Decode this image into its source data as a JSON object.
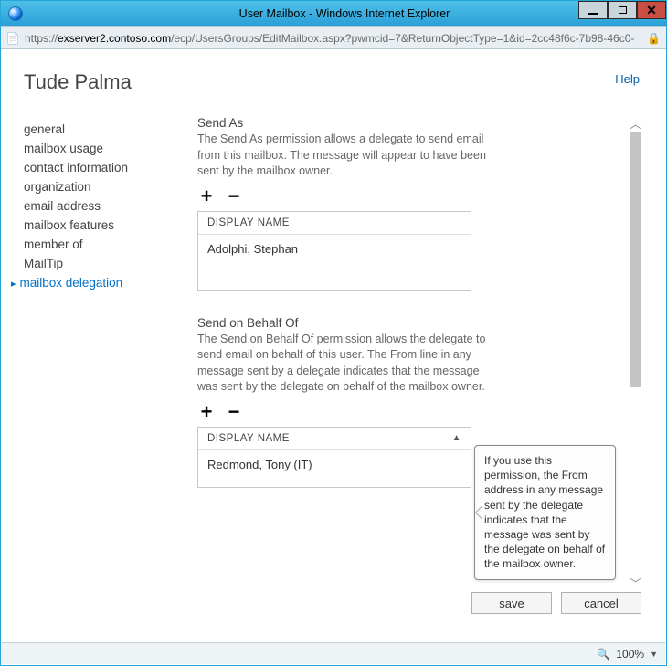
{
  "window": {
    "title": "User Mailbox - Windows Internet Explorer"
  },
  "addressbar": {
    "scheme": "https://",
    "host": "exserver2.contoso.com",
    "path": "/ecp/UsersGroups/EditMailbox.aspx?pwmcid=7&ReturnObjectType=1&id=2cc48f6c-7b98-46c0-"
  },
  "page": {
    "help_label": "Help",
    "title": "Tude Palma"
  },
  "sidebar": {
    "items": [
      {
        "label": "general"
      },
      {
        "label": "mailbox usage"
      },
      {
        "label": "contact information"
      },
      {
        "label": "organization"
      },
      {
        "label": "email address"
      },
      {
        "label": "mailbox features"
      },
      {
        "label": "member of"
      },
      {
        "label": "MailTip"
      },
      {
        "label": "mailbox delegation"
      }
    ],
    "active_index": 8
  },
  "sections": {
    "send_as": {
      "title": "Send As",
      "description": "The Send As permission allows a delegate to send email from this mailbox. The message will appear to have been sent by the mailbox owner.",
      "header": "DISPLAY NAME",
      "rows": [
        "Adolphi, Stephan"
      ]
    },
    "send_on_behalf": {
      "title": "Send on Behalf Of",
      "description": "The Send on Behalf Of permission allows the delegate to send email on behalf of this user. The From line in any message sent by a delegate indicates that the message was sent by the delegate on behalf of the mailbox owner.",
      "header": "DISPLAY NAME",
      "rows": [
        "Redmond, Tony (IT)"
      ]
    }
  },
  "tooltip": {
    "text": "If you use this permission, the From address in any message sent by the delegate indicates that the message was sent by the delegate on behalf of the mailbox owner."
  },
  "buttons": {
    "save": "save",
    "cancel": "cancel"
  },
  "status": {
    "zoom": "100%"
  }
}
